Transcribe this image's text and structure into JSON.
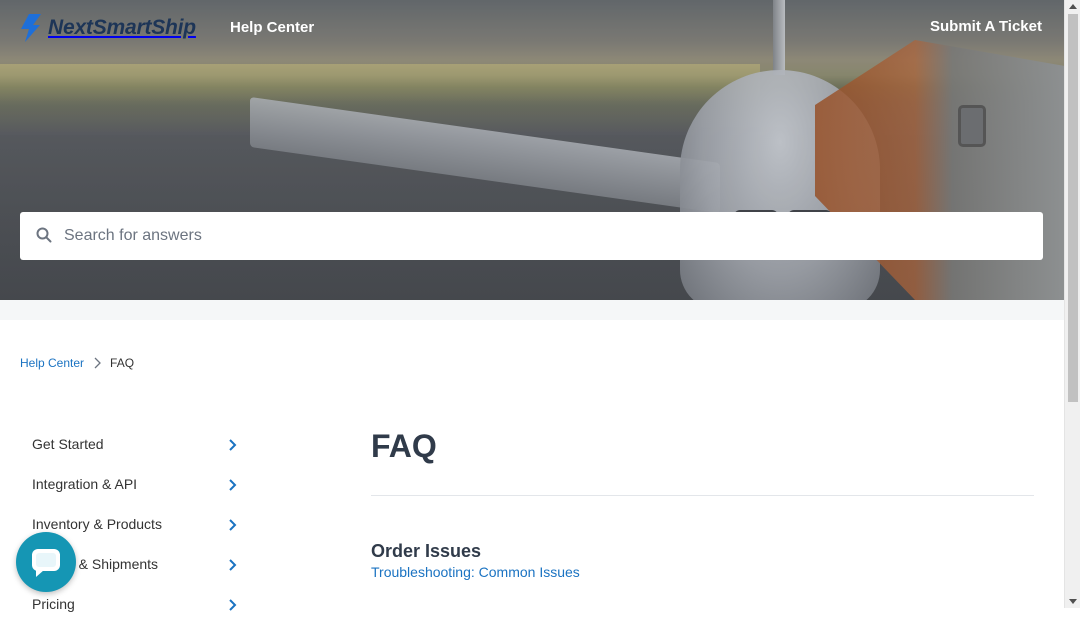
{
  "header": {
    "brand": "NextSmartShip",
    "help_center_link": "Help Center",
    "submit_ticket_link": "Submit A Ticket"
  },
  "search": {
    "placeholder": "Search for answers",
    "value": ""
  },
  "breadcrumb": {
    "home": "Help Center",
    "current": "FAQ"
  },
  "sidebar": {
    "items": [
      {
        "label": "Get Started"
      },
      {
        "label": "Integration & API"
      },
      {
        "label": "Inventory & Products"
      },
      {
        "label": "Orders & Shipments"
      },
      {
        "label": "Pricing"
      }
    ]
  },
  "main": {
    "title": "FAQ",
    "sections": [
      {
        "title": "Order Issues",
        "articles": [
          "Troubleshooting: Common Issues"
        ]
      }
    ]
  },
  "colors": {
    "link": "#1b73c2",
    "brand_blue": "#1e6fd9",
    "heading": "#303b4a",
    "chat": "#1596b4"
  },
  "icons": {
    "logo": "lightning-bolt-icon",
    "search": "search-icon",
    "chevron": "chevron-right-icon",
    "chat": "chat-bubble-icon"
  }
}
